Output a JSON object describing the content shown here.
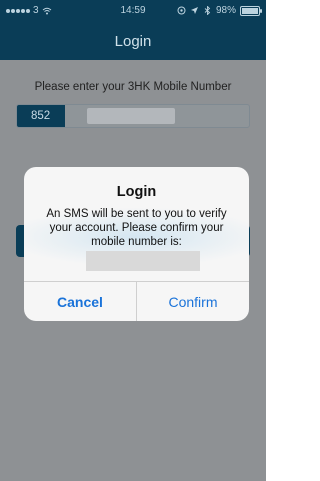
{
  "status_bar": {
    "carrier": "3",
    "time": "14:59",
    "battery": "98%",
    "battery_level": 0.98
  },
  "nav": {
    "title": "Login"
  },
  "screen": {
    "prompt": "Please enter your 3HK Mobile Number",
    "country_code": "852",
    "number_value": ""
  },
  "dialog": {
    "title": "Login",
    "message": "An SMS will be sent to you to verify your account. Please confirm your mobile number is:",
    "cancel_label": "Cancel",
    "confirm_label": "Confirm"
  },
  "colors": {
    "nav_bar": "#0a3d57",
    "dialog_button": "#1a73d9",
    "dim_overlay": "#8e9194"
  },
  "icons": [
    "signal-dots-icon",
    "wifi-icon",
    "location-icon",
    "bluetooth-icon",
    "battery-icon"
  ]
}
